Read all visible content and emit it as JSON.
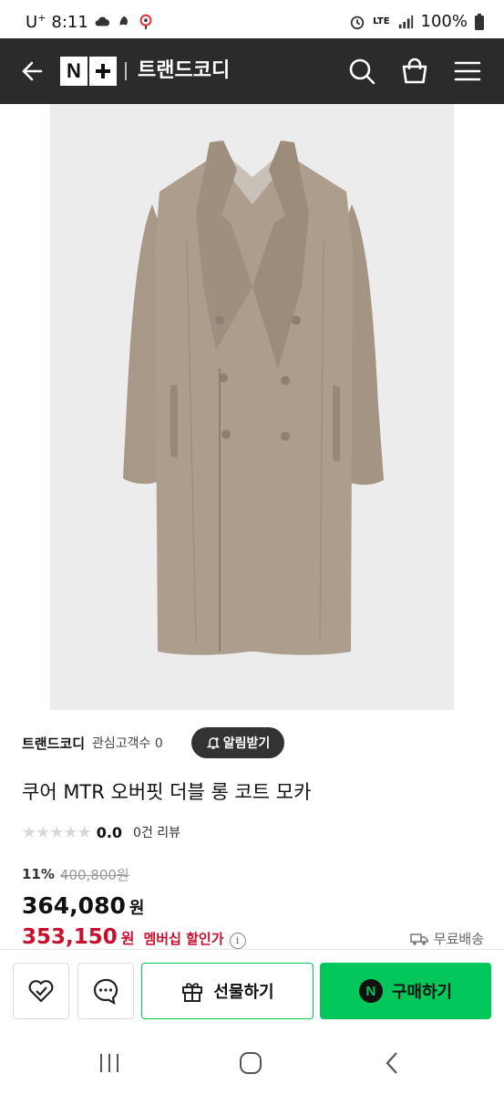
{
  "status_bar": {
    "carrier": "U",
    "carrier_sup": "+",
    "time": "8:11",
    "network": "LTE",
    "battery": "100%"
  },
  "header": {
    "logo_n": "N",
    "store_name": "트랜드코디"
  },
  "store": {
    "name": "트랜드코디",
    "followers": "관심고객수 0",
    "alarm_button": "알림받기"
  },
  "product": {
    "title": "쿠어 MTR 오버핏 더블 롱 코트 모카",
    "stars": "★★★★★",
    "rating": "0.0",
    "reviews": "0건 리뷰",
    "discount": "11%",
    "original_price": "400,800원",
    "price": "364,080",
    "price_unit": "원",
    "member_price": "353,150",
    "member_unit": "원",
    "member_label": "멤버십 할인가",
    "shipping": "무료배송"
  },
  "actions": {
    "gift_label": "선물하기",
    "buy_label": "구매하기",
    "buy_badge": "N"
  },
  "colors": {
    "header_bg": "#2b2b2b",
    "accent_green": "#03c75a",
    "member_red": "#c8102e",
    "coat": "#a89888"
  }
}
